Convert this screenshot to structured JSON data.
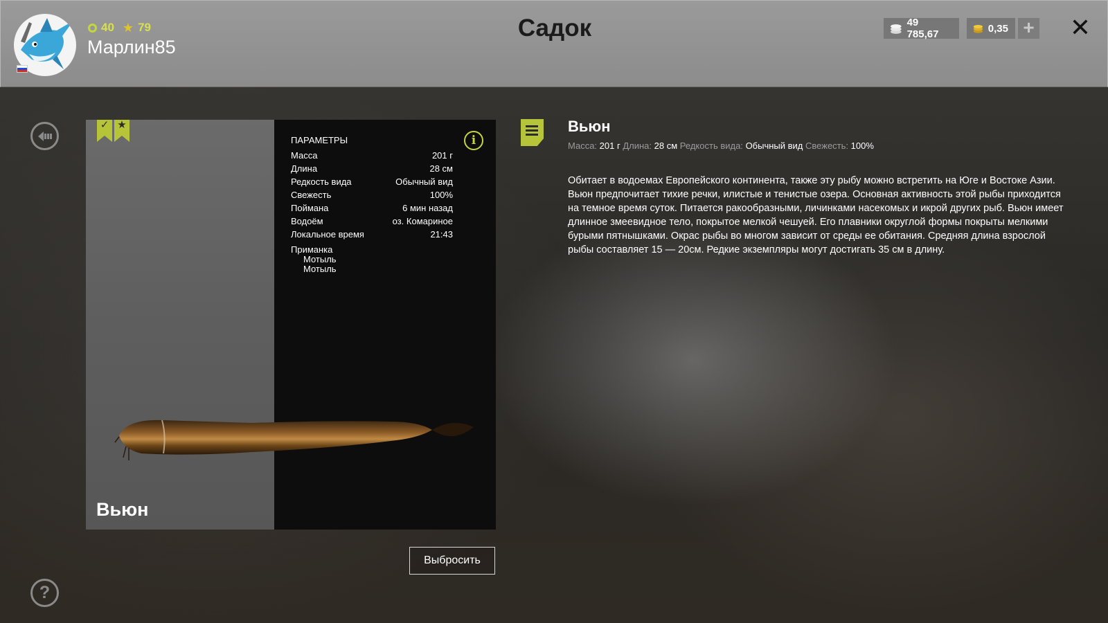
{
  "header": {
    "title": "Садок",
    "player": {
      "name": "Марлин85",
      "level": "40",
      "rank": "79"
    },
    "currency": {
      "silver": "49 785,67",
      "gold": "0,35"
    },
    "icons": {
      "add": "plus-icon",
      "close": "close-icon"
    }
  },
  "fish": {
    "name": "Вьюн",
    "params_title": "ПАРАМЕТРЫ",
    "params": [
      {
        "label": "Масса",
        "value": "201 г"
      },
      {
        "label": "Длина",
        "value": "28 см"
      },
      {
        "label": "Редкость вида",
        "value": "Обычный вид"
      },
      {
        "label": "Свежесть",
        "value": "100%"
      },
      {
        "label": "Поймана",
        "value": "6 мин назад"
      },
      {
        "label": "Водоём",
        "value": "оз. Комариное"
      },
      {
        "label": "Локальное время",
        "value": "21:43"
      }
    ],
    "bait_label": "Приманка",
    "baits": [
      "Мотыль",
      "Мотыль"
    ],
    "discard_label": "Выбросить"
  },
  "description": {
    "title": "Вьюн",
    "meta": {
      "mass_label": "Масса:",
      "mass": "201 г",
      "length_label": "Длина:",
      "length": "28 см",
      "rarity_label": "Редкость вида:",
      "rarity": "Обычный вид",
      "freshness_label": "Свежесть:",
      "freshness": "100%"
    },
    "text": "Обитает в водоемах Европейского континента, также эту рыбу можно встретить на Юге и Востоке Азии. Вьюн предпочитает тихие речки, илистые и тенистые озера. Основная активность этой рыбы приходится на темное время суток. Питается ракообразными, личинками насекомых и икрой других рыб. Вьюн имеет длинное змеевидное тело, покрытое мелкой чешуей. Его плавники округлой формы покрыты мелкими бурыми пятнышками. Окрас рыбы во многом зависит от среды ее обитания. Средняя длина взрослой рыбы составляет 15 — 20см. Редкие экземпляры могут достигать 35 см в длину."
  },
  "colors": {
    "accent": "#b6c43a",
    "header_bg": "#939393"
  }
}
